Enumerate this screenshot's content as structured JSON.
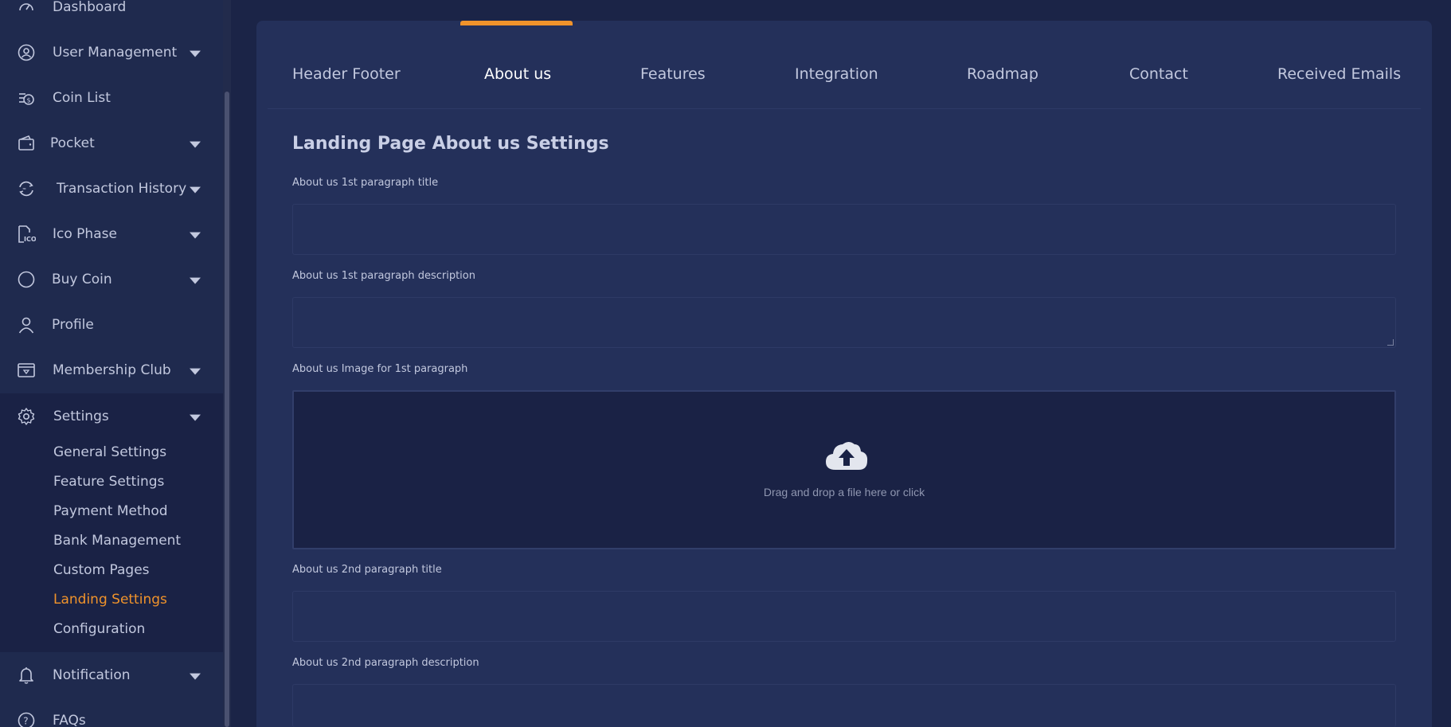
{
  "sidebar": {
    "items": [
      {
        "label": "Dashboard",
        "icon": "gauge-icon",
        "has_caret": false
      },
      {
        "label": "User Management",
        "icon": "user-circle-icon",
        "has_caret": true
      },
      {
        "label": "Coin List",
        "icon": "coin-list-icon",
        "has_caret": false
      },
      {
        "label": "Pocket",
        "icon": "wallet-icon",
        "has_caret": true
      },
      {
        "label": "Transaction History",
        "icon": "exchange-icon",
        "has_caret": true
      },
      {
        "label": "Ico Phase",
        "icon": "ico-file-icon",
        "has_caret": true
      },
      {
        "label": "Buy Coin",
        "icon": "circle-icon",
        "has_caret": true
      },
      {
        "label": "Profile",
        "icon": "person-icon",
        "has_caret": false
      },
      {
        "label": "Membership Club",
        "icon": "membership-card-icon",
        "has_caret": true
      },
      {
        "label": "Settings",
        "icon": "gear-icon",
        "has_caret": true
      },
      {
        "label": "Notification",
        "icon": "bell-icon",
        "has_caret": true
      },
      {
        "label": "FAQs",
        "icon": "question-icon",
        "has_caret": false
      }
    ],
    "settings_sub": [
      {
        "label": "General Settings",
        "active": false
      },
      {
        "label": "Feature Settings",
        "active": false
      },
      {
        "label": "Payment Method",
        "active": false
      },
      {
        "label": "Bank Management",
        "active": false
      },
      {
        "label": "Custom Pages",
        "active": false
      },
      {
        "label": "Landing Settings",
        "active": true
      },
      {
        "label": "Configuration",
        "active": false
      }
    ]
  },
  "tabs": [
    {
      "label": "Header Footer",
      "active": false
    },
    {
      "label": "About us",
      "active": true
    },
    {
      "label": "Features",
      "active": false
    },
    {
      "label": "Integration",
      "active": false
    },
    {
      "label": "Roadmap",
      "active": false
    },
    {
      "label": "Contact",
      "active": false
    },
    {
      "label": "Received Emails",
      "active": false
    }
  ],
  "main": {
    "section_title": "Landing Page About us Settings",
    "fields": [
      {
        "label": "About us 1st paragraph title",
        "value": "",
        "type": "input"
      },
      {
        "label": "About us 1st paragraph description",
        "value": "",
        "type": "textarea"
      },
      {
        "label": "About us Image for 1st paragraph",
        "type": "dropzone"
      },
      {
        "label": "About us 2nd paragraph title",
        "value": "",
        "type": "input"
      },
      {
        "label": "About us 2nd paragraph description",
        "value": "",
        "type": "textarea"
      }
    ],
    "dropzone_message": "Drag and drop a file here or click"
  },
  "colors": {
    "accent": "#f0932b",
    "background": "#1b2447",
    "panel": "#24305a",
    "sidebar": "#1f2a4e"
  }
}
